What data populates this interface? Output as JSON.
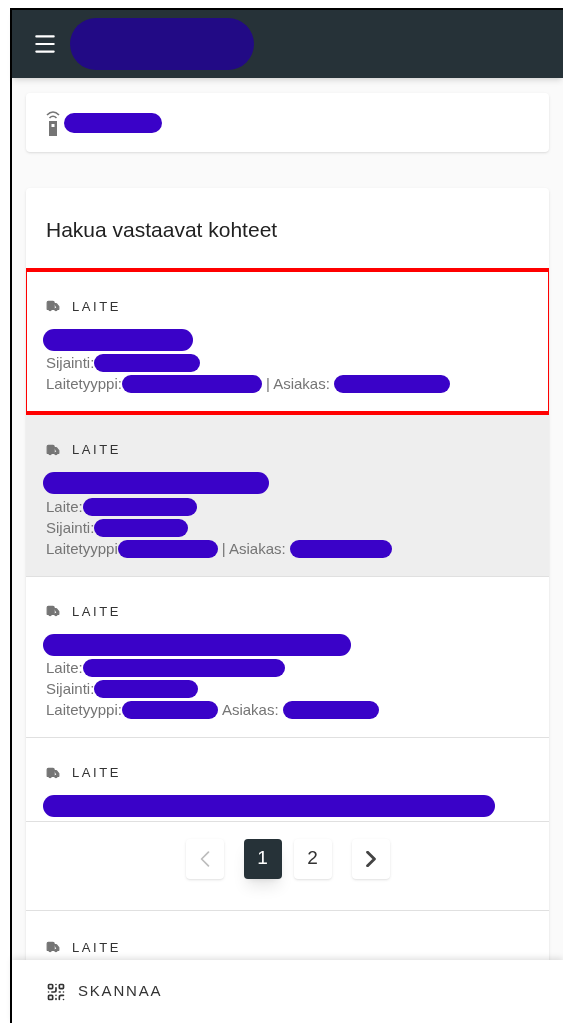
{
  "results": {
    "title": "Hakua vastaavat kohteet",
    "items": [
      {
        "type": "LAITE",
        "selected": true,
        "hovered": false,
        "lines": [
          {
            "label": "Sijainti:"
          },
          {
            "label": "Laitetyyppi:",
            "extra": "| Asiakas:"
          }
        ]
      },
      {
        "type": "LAITE",
        "selected": false,
        "hovered": true,
        "lines": [
          {
            "label": "Laite:"
          },
          {
            "label": "Sijainti:"
          },
          {
            "label": "Laitetyyppi",
            "extra": "| Asiakas:"
          }
        ]
      },
      {
        "type": "LAITE",
        "selected": false,
        "hovered": false,
        "lines": [
          {
            "label": "Laite:"
          },
          {
            "label": "Sijainti:"
          },
          {
            "label": "Laitetyyppi:",
            "extra": "Asiakas:"
          }
        ]
      },
      {
        "type": "LAITE",
        "selected": false,
        "hovered": false
      }
    ],
    "pagination": [
      {
        "kind": "prev",
        "disabled": true
      },
      {
        "kind": "page",
        "label": "1",
        "selected": true
      },
      {
        "kind": "page",
        "label": "2",
        "selected": false
      },
      {
        "kind": "next",
        "disabled": false
      }
    ],
    "after_items": [
      {
        "type": "LAITE"
      }
    ]
  },
  "bottom_bar": {
    "label": "SKANNAA"
  }
}
